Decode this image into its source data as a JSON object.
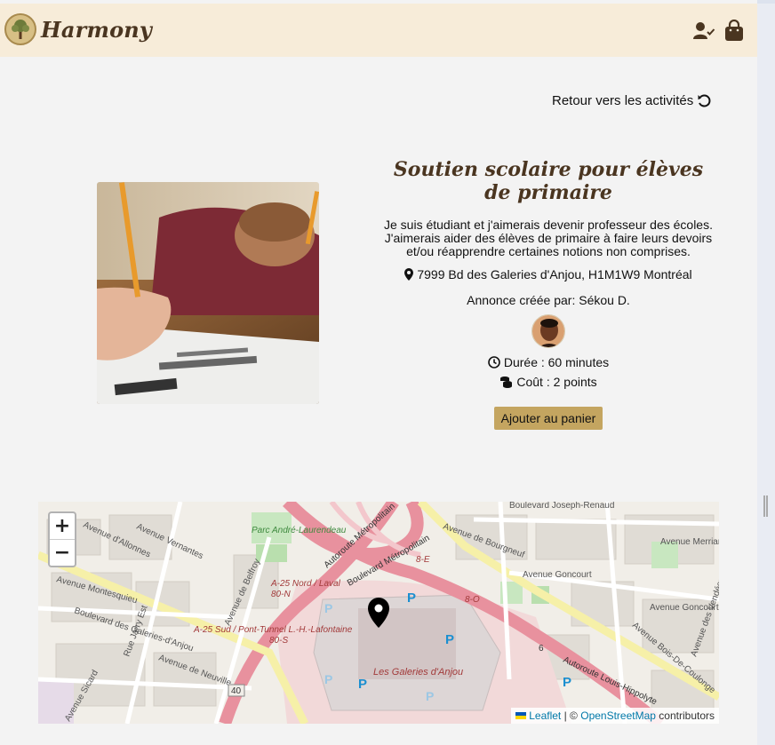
{
  "navbar": {
    "brand": "Harmony",
    "user_icon": "user-check-icon",
    "bag_icon": "shopping-bag-icon",
    "logo": "tree-logo"
  },
  "back_link": {
    "label": "Retour vers les activités",
    "icon": "undo-icon"
  },
  "activity": {
    "title": "Soutien scolaire pour élèves de primaire",
    "description": "Je suis étudiant et j'aimerais devenir professeur des écoles. J'aimerais aider des élèves de primaire à faire leurs devoirs et/ou réapprendre certaines notions non comprises.",
    "address": "7999 Bd des Galeries d'Anjou, H1M1W9 Montréal",
    "creator": "Annonce créée par: Sékou D.",
    "duration": "Durée : 60 minutes",
    "cost": "Coût : 2 points",
    "add_to_cart": "Ajouter au panier"
  },
  "map": {
    "zoom_in": "+",
    "zoom_out": "−",
    "labels": {
      "parc": "Parc André-Laurendeau",
      "joseph": "Boulevard Joseph-Renaud",
      "merriam": "Avenue Merriam",
      "goncourt1": "Avenue Goncourt",
      "goncourt2": "Avenue Goncourt",
      "metro1": "Autoroute Métropolitain",
      "metro2": "Boulevard Métropolitain",
      "e8": "8-E",
      "o8": "8-O",
      "a25n": "A-25 Nord / Laval",
      "n80": "80-N",
      "a25s": "A-25 Sud / Pont-Tunnel L.-H.-Lafontaine",
      "s80": "80-S",
      "galeries": "Les Galeries d'Anjou",
      "louis": "Autoroute Louis-Hippolyte",
      "galblvd": "Boulevard des Galeries-d'Anjou",
      "montesquieu": "Avenue Montesquieu",
      "allonnes": "Avenue d'Allonnes",
      "vernantes": "Avenue Vernantes",
      "belfroy": "Avenue de Belfroy",
      "neuville": "Avenue de Neuville",
      "jarry": "Rue Jarry Est",
      "sicard": "Avenue Sicard",
      "bourgneuf": "Avenue de Bourgneuf",
      "bois": "Avenue Bois-De-Coulonge",
      "vendeens": "Avenue des Vendéens",
      "r40": "40",
      "r6": "6",
      "parking": "P"
    },
    "attribution": {
      "leaflet": "Leaflet",
      "separator": "| ©",
      "osm": "OpenStreetMap",
      "contributors": "contributors"
    }
  },
  "colors": {
    "navbar_bg": "#f7ecd9",
    "brand": "#4a3520",
    "button": "#c4a560",
    "page_bg": "#f3f3f3"
  }
}
